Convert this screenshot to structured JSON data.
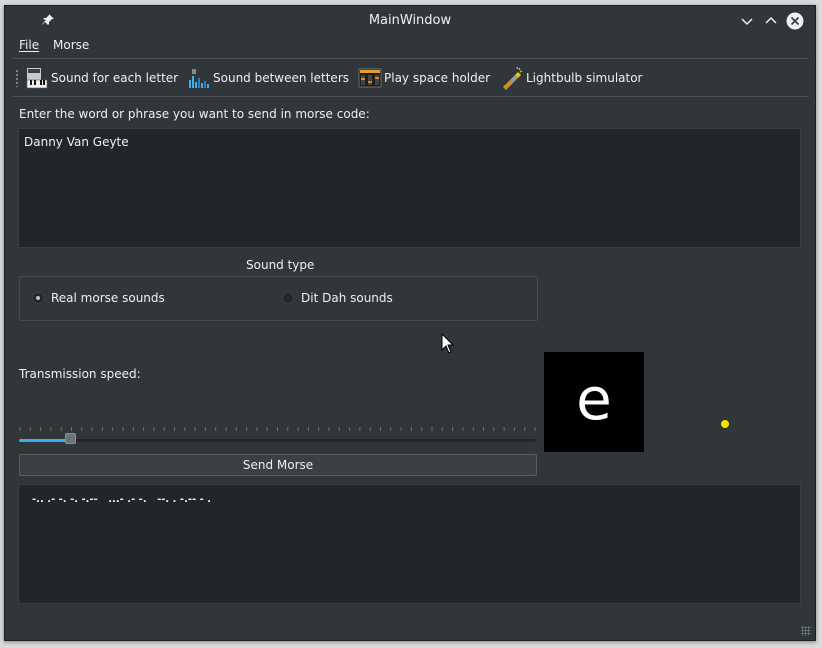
{
  "window": {
    "title": "MainWindow"
  },
  "menu": {
    "file": "File",
    "morse": "Morse"
  },
  "toolbar": {
    "items": [
      {
        "label": "Sound for each letter",
        "icon": "piano-icon"
      },
      {
        "label": "Sound between letters",
        "icon": "equalizer-icon"
      },
      {
        "label": "Play space holder",
        "icon": "mixer-icon"
      },
      {
        "label": "Lightbulb simulator",
        "icon": "flashlight-icon"
      }
    ]
  },
  "input": {
    "prompt": "Enter the word or phrase you want to send in morse code:",
    "value": "Danny Van Geyte"
  },
  "sound_type": {
    "title": "Sound type",
    "options": [
      {
        "label": "Real morse sounds",
        "selected": true
      },
      {
        "label": "Dit Dah sounds",
        "selected": false
      }
    ]
  },
  "speed": {
    "label": "Transmission speed:",
    "value_fraction": 0.09
  },
  "send_button": "Send Morse",
  "lightbulb": {
    "letter": "e"
  },
  "indicator": {
    "color": "#f5e400"
  },
  "output": {
    "text": "-.. .- -. -. -.--   ...- .- -.   --. . -.-- - ."
  },
  "colors": {
    "accent": "#3daee9",
    "background": "#31363b",
    "field": "#232629"
  }
}
